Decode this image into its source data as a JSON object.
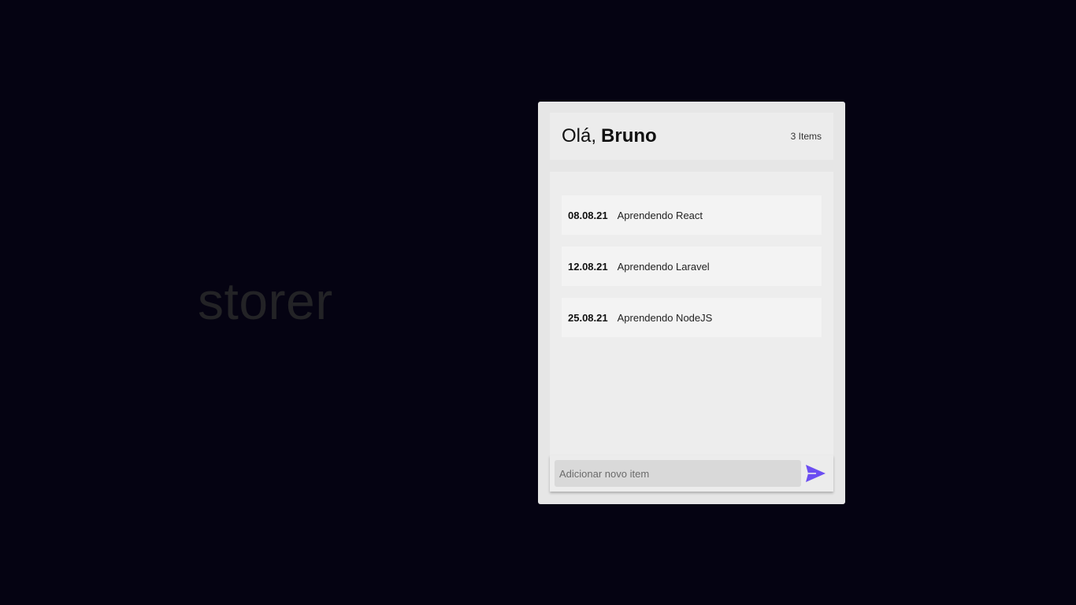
{
  "brand": {
    "text": "storer"
  },
  "header": {
    "greeting_prefix": "Olá,",
    "user_name": "Bruno",
    "item_count": "3 Items"
  },
  "items": [
    {
      "date": "08.08.21",
      "text": "Aprendendo React"
    },
    {
      "date": "12.08.21",
      "text": "Aprendendo Laravel"
    },
    {
      "date": "25.08.21",
      "text": "Aprendendo NodeJS"
    }
  ],
  "new_item": {
    "placeholder": "Adicionar novo item",
    "value": ""
  },
  "icons": {
    "send": "send-icon"
  },
  "colors": {
    "background": "#050312",
    "accent": "#6c4ef2",
    "card": "#e6e6e6"
  }
}
